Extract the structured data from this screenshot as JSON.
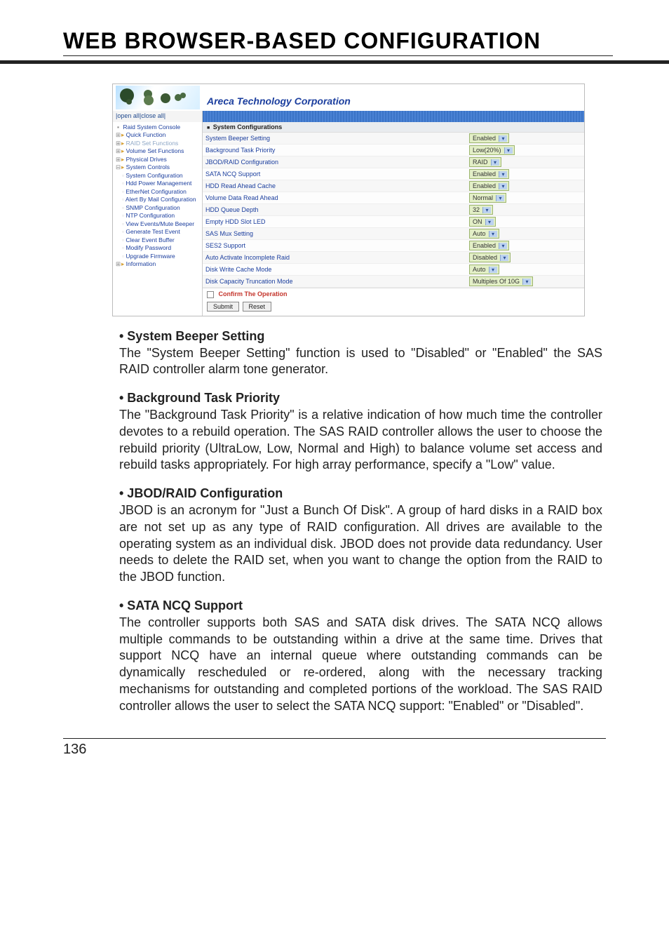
{
  "header": {
    "title": "WEB BROWSER-BASED CONFIGURATION"
  },
  "corp_name": "Areca Technology Corporation",
  "tree_controls": "|open all|close all|",
  "tree": {
    "root": "Raid System Console",
    "quick": "Quick Function",
    "raidset": "RAID Set Functions",
    "volset": "Volume Set Functions",
    "phys": "Physical Drives",
    "sysctl": "System Controls",
    "items": [
      "System Configuration",
      "Hdd Power Management",
      "EtherNet Configuration",
      "Alert By Mail Configuration",
      "SNMP Configuration",
      "NTP Configuration",
      "View Events/Mute Beeper",
      "Generate Test Event",
      "Clear Event Buffer",
      "Modify Password",
      "Upgrade Firmware"
    ],
    "info": "Information"
  },
  "cfg_title": "System Configurations",
  "settings": [
    {
      "label": "System Beeper Setting",
      "value": "Enabled"
    },
    {
      "label": "Background Task Priority",
      "value": "Low(20%)"
    },
    {
      "label": "JBOD/RAID Configuration",
      "value": "RAID"
    },
    {
      "label": "SATA NCQ Support",
      "value": "Enabled"
    },
    {
      "label": "HDD Read Ahead Cache",
      "value": "Enabled"
    },
    {
      "label": "Volume Data Read Ahead",
      "value": "Normal"
    },
    {
      "label": "HDD Queue Depth",
      "value": "32"
    },
    {
      "label": "Empty HDD Slot LED",
      "value": "ON"
    },
    {
      "label": "SAS Mux Setting",
      "value": "Auto"
    },
    {
      "label": "SES2 Support",
      "value": "Enabled"
    },
    {
      "label": "Auto Activate Incomplete Raid",
      "value": "Disabled"
    },
    {
      "label": "Disk Write Cache Mode",
      "value": "Auto"
    },
    {
      "label": "Disk Capacity Truncation Mode",
      "value": "Multiples Of 10G"
    }
  ],
  "confirm_label": "Confirm The Operation",
  "buttons": {
    "submit": "Submit",
    "reset": "Reset"
  },
  "sections": [
    {
      "title": "• System Beeper Setting",
      "body": "The \"System Beeper Setting\" function is used to \"Disabled\" or \"Enabled\" the SAS RAID controller alarm tone generator."
    },
    {
      "title": "• Background Task Priority",
      "body": "The \"Background Task Priority\" is a relative indication of how much time the controller devotes to a rebuild operation. The SAS RAID controller allows the user to choose the rebuild priority (UltraLow, Low, Normal and High) to balance volume set access and rebuild tasks appropriately. For high array performance, specify a \"Low\" value."
    },
    {
      "title": "• JBOD/RAID Configuration",
      "body": "JBOD is an acronym for \"Just a Bunch Of Disk\". A group of hard disks in a RAID box are not set up as any type of RAID configuration. All drives are available to the operating system as an individual disk. JBOD does not provide data redundancy. User needs to delete the RAID set, when you want to change the option from the RAID to the JBOD function."
    },
    {
      "title": "• SATA NCQ Support",
      "body": "The controller supports both SAS and SATA disk drives. The SATA NCQ allows multiple commands to be outstanding within a drive at the same time. Drives that support NCQ have an internal queue where outstanding commands can be dynamically rescheduled or re-ordered, along with the necessary tracking mechanisms for outstanding and completed portions of the workload. The SAS RAID controller allows the user to select the SATA NCQ support: \"Enabled\" or \"Disabled\"."
    }
  ],
  "page_number": "136"
}
